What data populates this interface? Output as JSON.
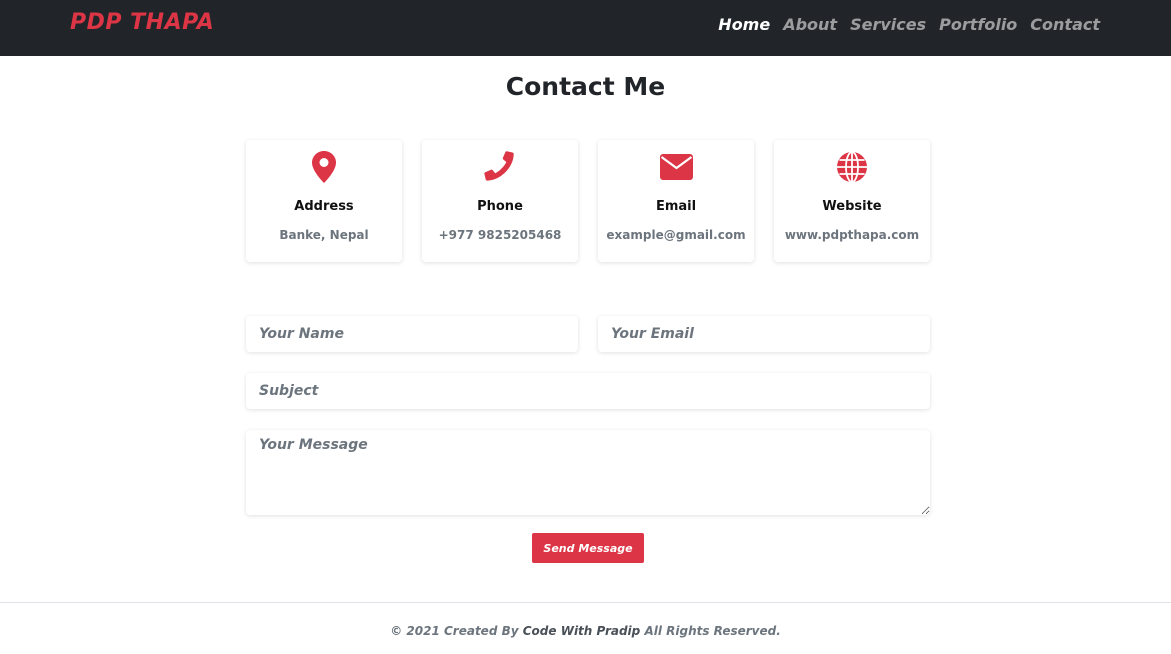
{
  "navbar": {
    "brand": "PDP THAPA",
    "links": [
      {
        "label": "Home",
        "active": true
      },
      {
        "label": "About",
        "active": false
      },
      {
        "label": "Services",
        "active": false
      },
      {
        "label": "Portfolio",
        "active": false
      },
      {
        "label": "Contact",
        "active": false
      }
    ]
  },
  "page": {
    "title": "Contact Me"
  },
  "cards": [
    {
      "icon": "map-pin-icon",
      "label": "Address",
      "value": "Banke, Nepal"
    },
    {
      "icon": "phone-icon",
      "label": "Phone",
      "value": "+977 9825205468"
    },
    {
      "icon": "envelope-icon",
      "label": "Email",
      "value": "example@gmail.com"
    },
    {
      "icon": "globe-icon",
      "label": "Website",
      "value": "www.pdpthapa.com"
    }
  ],
  "form": {
    "name_placeholder": "Your Name",
    "email_placeholder": "Your Email",
    "subject_placeholder": "Subject",
    "message_placeholder": "Your Message",
    "submit_label": "Send Message"
  },
  "footer": {
    "prefix": "© 2021 Created By",
    "author": "Code With Pradip",
    "suffix": "All Rights Reserved."
  },
  "colors": {
    "accent": "#dc3545",
    "navbar_bg": "#212529",
    "muted_text": "#6c757d"
  }
}
